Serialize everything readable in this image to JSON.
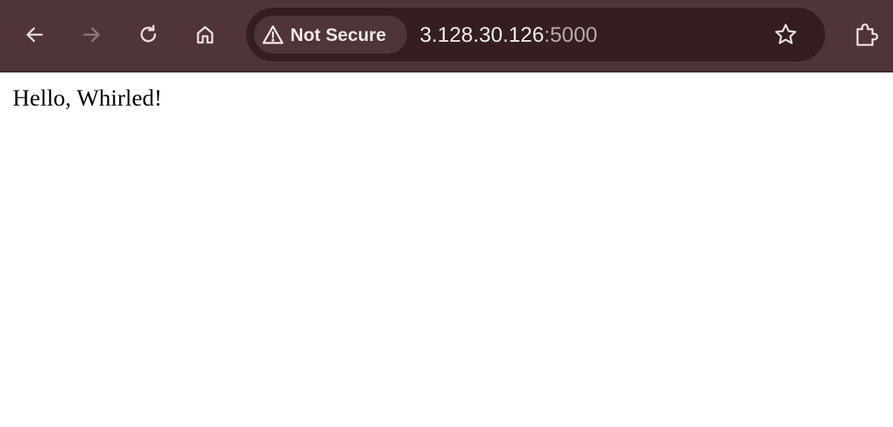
{
  "toolbar": {
    "back_icon": "arrow-left-icon",
    "forward_icon": "arrow-right-icon",
    "reload_icon": "reload-icon",
    "home_icon": "home-icon",
    "bookmark_icon": "star-icon",
    "extensions_icon": "puzzle-piece-icon",
    "forward_enabled": false
  },
  "address_bar": {
    "security_label": "Not Secure",
    "security_icon": "warning-triangle-icon",
    "url_host": "3.128.30.126",
    "url_port": ":5000"
  },
  "page": {
    "text": "Hello, Whirled!"
  },
  "colors": {
    "toolbar_bg": "#4f3539",
    "omnibox_bg": "#351e22",
    "icon": "#e8dcdd",
    "icon_disabled": "#8e7a7d"
  }
}
